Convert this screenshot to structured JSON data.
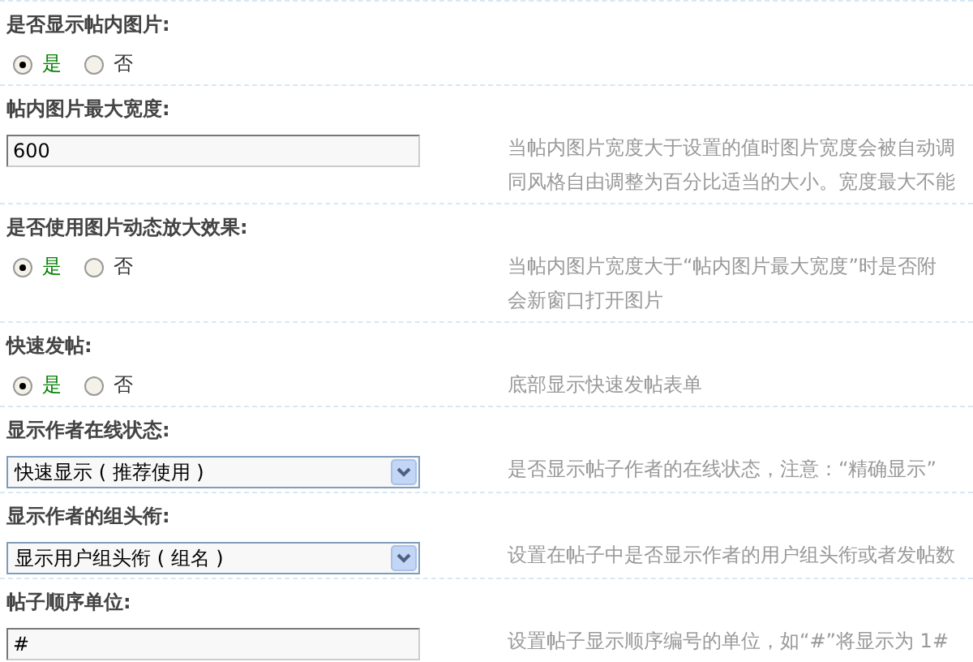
{
  "settings": [
    {
      "label": "是否显示帖内图片:",
      "kind": "radio",
      "options": [
        {
          "label": "是",
          "selected": true
        },
        {
          "label": "否",
          "selected": false
        }
      ]
    },
    {
      "label": "帖内图片最大宽度:",
      "kind": "text",
      "value": "600",
      "description": [
        "当帖内图片宽度大于设置的值时图片宽度会被自动调",
        "同风格自由调整为百分比适当的大小。宽度最大不能"
      ]
    },
    {
      "label": "是否使用图片动态放大效果:",
      "kind": "radio",
      "options": [
        {
          "label": "是",
          "selected": true
        },
        {
          "label": "否",
          "selected": false
        }
      ],
      "description": [
        "当帖内图片宽度大于“帖内图片最大宽度”时是否附",
        "会新窗口打开图片"
      ]
    },
    {
      "label": "快速发帖:",
      "kind": "radio",
      "options": [
        {
          "label": "是",
          "selected": true
        },
        {
          "label": "否",
          "selected": false
        }
      ],
      "description": [
        "底部显示快速发帖表单"
      ]
    },
    {
      "label": "显示作者在线状态:",
      "kind": "select",
      "value": "快速显示 ( 推荐使用 )",
      "description": [
        "是否显示帖子作者的在线状态，注意：“精确显示”"
      ]
    },
    {
      "label": "显示作者的组头衔:",
      "kind": "select",
      "value": "显示用户组头衔 ( 组名 )",
      "description": [
        "设置在帖子中是否显示作者的用户组头衔或者发帖数"
      ]
    },
    {
      "label": "帖子顺序单位:",
      "kind": "text",
      "value": "#",
      "description": [
        "设置帖子显示顺序编号的单位，如“#”将显示为 1#"
      ]
    }
  ]
}
